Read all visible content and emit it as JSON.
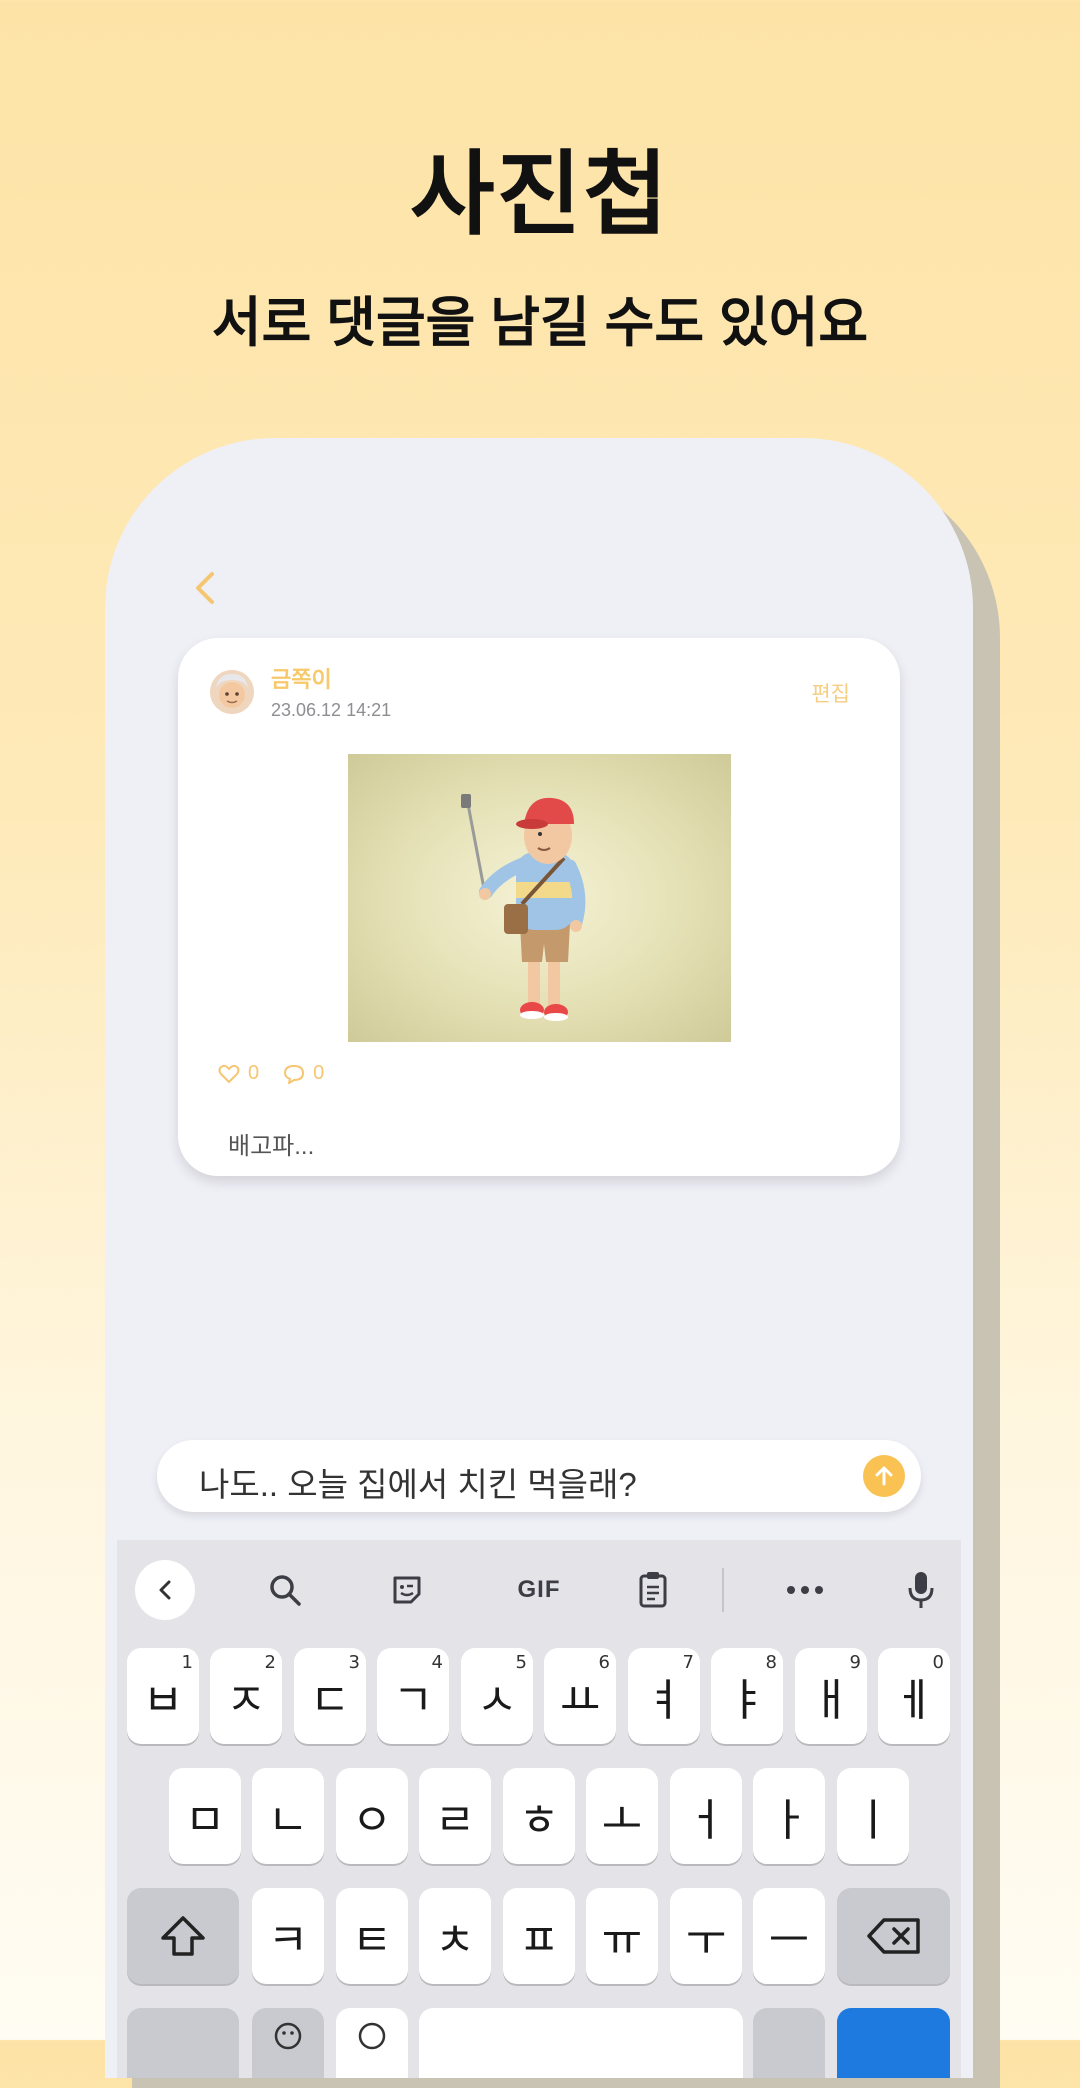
{
  "hero": {
    "title": "사진첩",
    "subtitle": "서로 댓글을 남길 수도 있어요"
  },
  "post": {
    "author": "금쪽이",
    "date": "23.06.12 14:21",
    "edit_label": "편집",
    "likes": "0",
    "comments": "0",
    "caption": "배고파..."
  },
  "comment_input": {
    "value": "나도.. 오늘 집에서 치킨 먹을래?"
  },
  "keyboard": {
    "toolbar": {
      "gif_label": "GIF"
    },
    "row1": [
      {
        "key": "ㅂ",
        "hint": "1"
      },
      {
        "key": "ㅈ",
        "hint": "2"
      },
      {
        "key": "ㄷ",
        "hint": "3"
      },
      {
        "key": "ㄱ",
        "hint": "4"
      },
      {
        "key": "ㅅ",
        "hint": "5"
      },
      {
        "key": "ㅛ",
        "hint": "6"
      },
      {
        "key": "ㅕ",
        "hint": "7"
      },
      {
        "key": "ㅑ",
        "hint": "8"
      },
      {
        "key": "ㅐ",
        "hint": "9"
      },
      {
        "key": "ㅔ",
        "hint": "0"
      }
    ],
    "row2": [
      "ㅁ",
      "ㄴ",
      "ㅇ",
      "ㄹ",
      "ㅎ",
      "ㅗ",
      "ㅓ",
      "ㅏ",
      "ㅣ"
    ],
    "row3": [
      "ㅋ",
      "ㅌ",
      "ㅊ",
      "ㅍ",
      "ㅠ",
      "ㅜ",
      "ㅡ"
    ]
  },
  "colors": {
    "accent": "#F9C253",
    "background_top": "#FDE3A6",
    "phone_bg": "#EFEFF6"
  }
}
